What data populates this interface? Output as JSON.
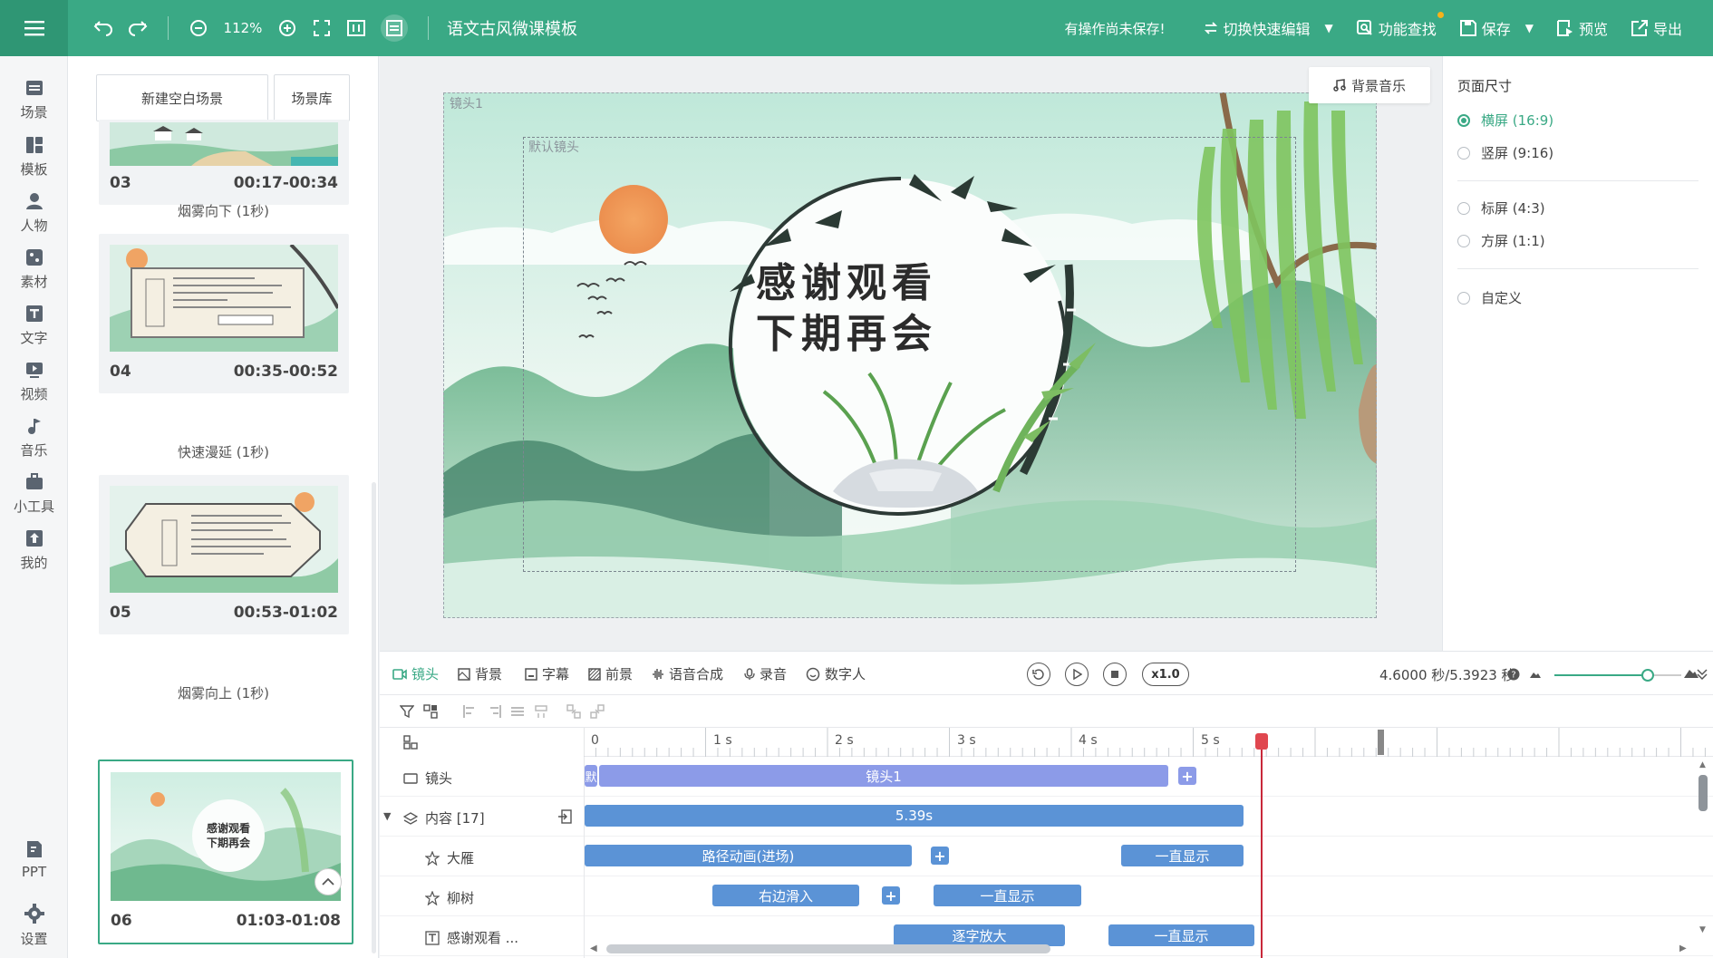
{
  "topbar": {
    "zoom": "112%",
    "doc_title": "语文古风微课模板",
    "unsaved_notice": "有操作尚未保存!",
    "switch_edit": "切换快速编辑",
    "find_feature": "功能查找",
    "save": "保存",
    "preview": "预览",
    "export": "导出"
  },
  "rail": {
    "items": [
      {
        "label": "场景",
        "icon": "scene-icon"
      },
      {
        "label": "模板",
        "icon": "template-icon"
      },
      {
        "label": "人物",
        "icon": "person-icon"
      },
      {
        "label": "素材",
        "icon": "material-icon"
      },
      {
        "label": "文字",
        "icon": "text-icon"
      },
      {
        "label": "视频",
        "icon": "video-icon"
      },
      {
        "label": "音乐",
        "icon": "music-icon"
      },
      {
        "label": "小工具",
        "icon": "toolbox-icon"
      },
      {
        "label": "我的",
        "icon": "upload-icon"
      },
      {
        "label": "PPT",
        "icon": "ppt-icon"
      },
      {
        "label": "设置",
        "icon": "gear-icon"
      }
    ]
  },
  "scenes": {
    "new_blank": "新建空白场景",
    "library": "场景库",
    "cards": [
      {
        "num": "03",
        "time": "00:17-00:34"
      },
      {
        "num": "04",
        "time": "00:35-00:52"
      },
      {
        "num": "05",
        "time": "00:53-01:02"
      },
      {
        "num": "06",
        "time": "01:03-01:08"
      }
    ],
    "transitions": [
      "烟雾向下 (1秒)",
      "快速漫延 (1秒)",
      "烟雾向上 (1秒)"
    ],
    "thumb06_line1": "感谢观看",
    "thumb06_line2": "下期再会"
  },
  "canvas": {
    "bg_music": "背景音乐",
    "frame1_label": "镜头1",
    "frame2_label": "默认镜头",
    "text_line1": "感谢观看",
    "text_line2": "下期再会"
  },
  "props": {
    "title": "页面尺寸",
    "options": [
      {
        "label": "横屏 (16:9)",
        "checked": true
      },
      {
        "label": "竖屏 (9:16)",
        "checked": false
      },
      {
        "label": "标屏 (4:3)",
        "checked": false
      },
      {
        "label": "方屏 (1:1)",
        "checked": false
      },
      {
        "label": "自定义",
        "checked": false
      }
    ]
  },
  "timeline": {
    "tabs": [
      "镜头",
      "背景",
      "字幕",
      "前景",
      "语音合成",
      "录音",
      "数字人"
    ],
    "speed": "x1.0",
    "time_readout": "4.6000 秒/5.3923 秒",
    "ruler": [
      "0",
      "1 s",
      "2 s",
      "3 s",
      "4 s",
      "5 s"
    ],
    "tracks": [
      {
        "name": "镜头",
        "clips": [
          "默",
          "镜头1"
        ]
      },
      {
        "name": "内容 [17]",
        "clips": [
          "5.39s"
        ]
      },
      {
        "name": "大雁",
        "clips": [
          "路径动画(进场)",
          "一直显示"
        ]
      },
      {
        "name": "柳树",
        "clips": [
          "右边滑入",
          "一直显示"
        ]
      },
      {
        "name": "感谢观看 ...",
        "clips": [
          "逐字放大",
          "一直显示"
        ]
      }
    ]
  },
  "colors": {
    "accent": "#3aa985",
    "clip_blue": "#5b93d6",
    "clip_purple": "#8c9be8",
    "playhead": "#c8283a"
  }
}
